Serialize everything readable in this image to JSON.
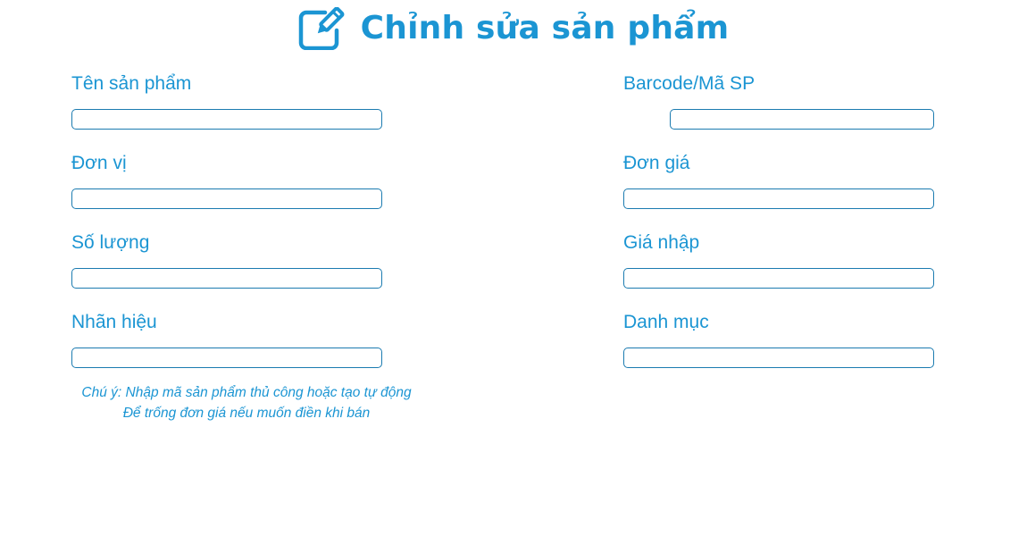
{
  "header": {
    "title": "Chỉnh sửa sản phẩm",
    "icon": "edit-icon"
  },
  "form": {
    "left": [
      {
        "key": "ten_san_pham",
        "label": "Tên sản phẩm",
        "value": ""
      },
      {
        "key": "don_vi",
        "label": "Đơn vị",
        "value": ""
      },
      {
        "key": "so_luong",
        "label": "Số lượng",
        "value": ""
      },
      {
        "key": "nhan_hieu",
        "label": "Nhãn hiệu",
        "value": ""
      }
    ],
    "right": [
      {
        "key": "barcode",
        "label": "Barcode/Mã SP",
        "value": ""
      },
      {
        "key": "don_gia",
        "label": "Đơn giá",
        "value": ""
      },
      {
        "key": "gia_nhap",
        "label": "Giá nhập",
        "value": ""
      },
      {
        "key": "danh_muc",
        "label": "Danh mục",
        "value": ""
      }
    ]
  },
  "note": {
    "line1": "Chú ý: Nhập mã sản phẩm thủ công hoặc tạo tự động",
    "line2": "Để trống đơn giá nếu muốn điền khi bán"
  },
  "colors": {
    "accent": "#1b95d3",
    "input_border": "#1b7bb0",
    "background": "#ffffff"
  }
}
